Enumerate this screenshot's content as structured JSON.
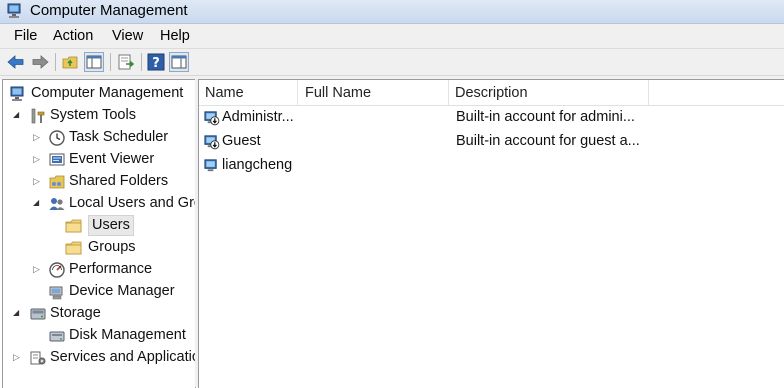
{
  "window": {
    "title": "Computer Management"
  },
  "menu": [
    "File",
    "Action",
    "View",
    "Help"
  ],
  "toolbar": {
    "buttons": [
      "back-arrow-icon",
      "forward-arrow-icon",
      "up-folder-icon",
      "show-hide-tree-icon",
      "export-list-icon",
      "help-icon",
      "show-hide-action-pane-icon"
    ]
  },
  "tree": [
    {
      "label": "Computer Management",
      "icon": "computer-management-icon",
      "arrow": "",
      "level": 0
    },
    {
      "label": "System Tools",
      "icon": "system-tools-icon",
      "arrow": "expanded",
      "level": 1
    },
    {
      "label": "Task Scheduler",
      "icon": "clock-icon",
      "arrow": "collapsed",
      "level": 2
    },
    {
      "label": "Event Viewer",
      "icon": "event-viewer-icon",
      "arrow": "collapsed",
      "level": 2
    },
    {
      "label": "Shared Folders",
      "icon": "shared-folder-icon",
      "arrow": "collapsed",
      "level": 2
    },
    {
      "label": "Local Users and Groups",
      "icon": "users-group-icon",
      "arrow": "expanded",
      "level": 2
    },
    {
      "label": "Users",
      "icon": "folder-icon",
      "arrow": "",
      "level": 3,
      "selected": true
    },
    {
      "label": "Groups",
      "icon": "folder-icon",
      "arrow": "",
      "level": 3
    },
    {
      "label": "Performance",
      "icon": "performance-icon",
      "arrow": "collapsed",
      "level": 2
    },
    {
      "label": "Device Manager",
      "icon": "device-manager-icon",
      "arrow": "",
      "level": 2
    },
    {
      "label": "Storage",
      "icon": "storage-icon",
      "arrow": "expanded",
      "level": 1
    },
    {
      "label": "Disk Management",
      "icon": "disk-management-icon",
      "arrow": "",
      "level": 2
    },
    {
      "label": "Services and Applications",
      "icon": "services-icon",
      "arrow": "collapsed",
      "level": 1
    }
  ],
  "list": {
    "columns": [
      "Name",
      "Full Name",
      "Description"
    ],
    "rows": [
      {
        "name": "Administr...",
        "full_name": "",
        "description": "Built-in account for admini...",
        "disabled": true
      },
      {
        "name": "Guest",
        "full_name": "",
        "description": "Built-in account for guest a...",
        "disabled": true
      },
      {
        "name": "liangcheng",
        "full_name": "",
        "description": "",
        "disabled": false
      }
    ]
  }
}
